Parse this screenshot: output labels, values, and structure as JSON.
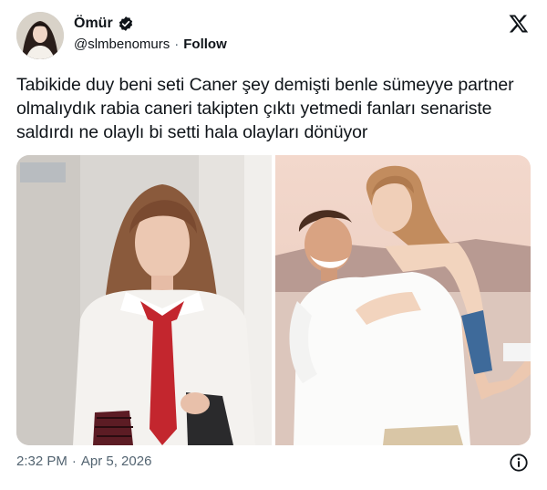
{
  "author": {
    "display_name": "Ömür",
    "handle": "@slmbenomurs",
    "separator": "·",
    "follow_label": "Follow",
    "verified_icon": "verified-badge-icon",
    "verified_color": "#0f1419"
  },
  "brand_icon": "x-logo-icon",
  "tweet": {
    "text": "Tabikide duy beni seti Caner şey demişti benle sümeyye partner olmalıydık rabia caneri takipten çıktı yetmedi fanları senariste saldırdı ne olaylı bi setti hala olayları dönüyor"
  },
  "media": {
    "count": 2
  },
  "footer": {
    "time": "2:32 PM",
    "separator": "·",
    "date": "Apr 5, 2026",
    "info_icon": "info-icon"
  },
  "colors": {
    "text_primary": "#0f1419",
    "text_secondary": "#536471",
    "background": "#ffffff"
  }
}
